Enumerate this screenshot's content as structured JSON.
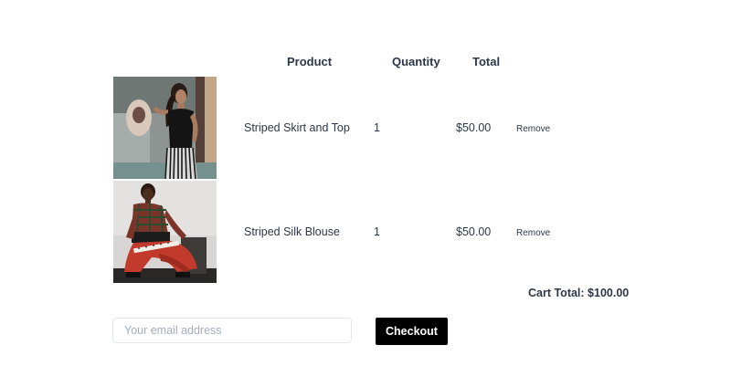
{
  "table": {
    "headers": {
      "product": "Product",
      "quantity": "Quantity",
      "total": "Total"
    },
    "rows": [
      {
        "image_icon": "model-photo-striped-skirt",
        "name": "Striped Skirt and Top",
        "quantity": "1",
        "total": "$50.00",
        "remove_label": "Remove"
      },
      {
        "image_icon": "model-photo-striped-blouse",
        "name": "Striped Silk Blouse",
        "quantity": "1",
        "total": "$50.00",
        "remove_label": "Remove"
      }
    ]
  },
  "cart": {
    "total_text": "Cart Total: $100.00"
  },
  "checkout": {
    "email_placeholder": "Your email address",
    "email_value": "",
    "button_label": "Checkout"
  },
  "colors": {
    "text": "#2d3748",
    "button_bg": "#000000",
    "button_text": "#ffffff",
    "input_border": "#e2e8f0",
    "placeholder": "#a0aec0"
  }
}
